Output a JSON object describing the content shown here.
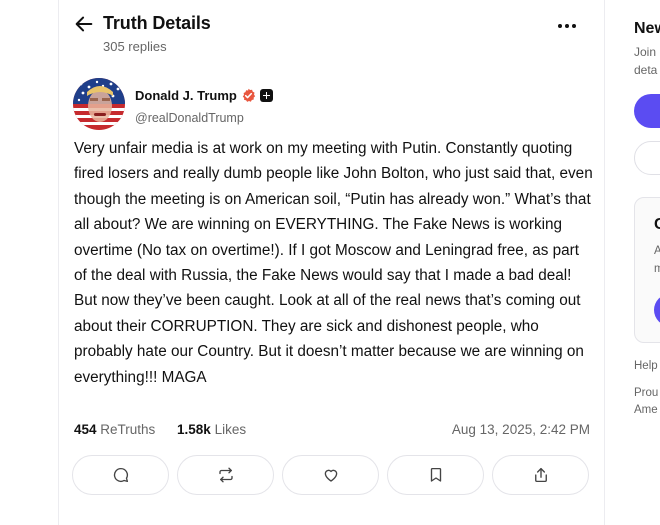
{
  "header": {
    "title": "Truth Details",
    "replies": "305 replies"
  },
  "post": {
    "author_name": "Donald J. Trump",
    "author_handle": "@realDonaldTrump",
    "text": "Very unfair media is at work on my meeting with Putin. Constantly quoting fired losers and really dumb people like John Bolton, who just said that, even though the meeting is on American soil, “Putin has already won.” What’s that all about? We are winning on EVERYTHING. The Fake News is working overtime (No tax on overtime!). If I got Moscow and Leningrad free, as part of the deal with Russia, the Fake News would say that I made a bad deal! But now they’ve been caught. Look at all of the real news that’s coming out about their CORRUPTION. They are sick and dishonest people, who probably hate our Country. But it doesn’t matter because we are winning on everything!!! MAGA",
    "retruths_count": "454",
    "retruths_label": "ReTruths",
    "likes_count": "1.58k",
    "likes_label": "Likes",
    "timestamp": "Aug 13, 2025, 2:42 PM"
  },
  "actions": {
    "icons": [
      "reply-icon",
      "retruth-icon",
      "like-icon",
      "bookmark-icon",
      "share-icon"
    ]
  },
  "right_sidebar": {
    "title_partial": "New",
    "subtitle_line1": "Join",
    "subtitle_line2": "deta",
    "card_title_partial": "C",
    "card_line1": "A",
    "card_line2": "m",
    "help_partial": "Help",
    "proud_line1": "Prou",
    "proud_line2": "Ame"
  },
  "colors": {
    "accent": "#5b4cf2",
    "verified": "#e8573f",
    "muted_text": "#666666",
    "border": "#e4e4e9"
  }
}
